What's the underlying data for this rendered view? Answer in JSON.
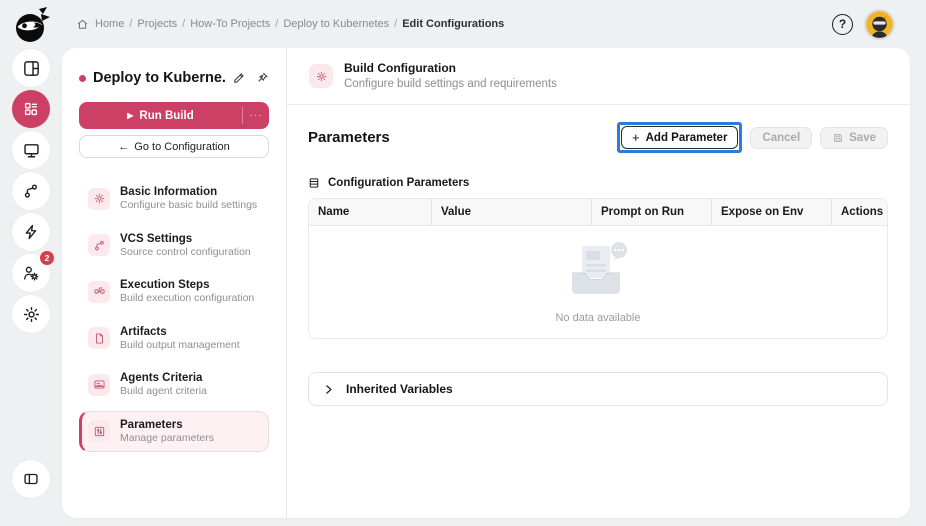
{
  "colors": {
    "accent": "#cd4066",
    "accent_light": "#fbe9ee",
    "highlight_blue": "#2b7ce0",
    "badge_red": "#d5404d",
    "page_bg": "#eef0f1"
  },
  "icons": {
    "breadcrumb_separator": "/",
    "play": "▶",
    "ellipsis": "···",
    "back_arrow": "←",
    "plus": "+",
    "help": "?"
  },
  "breadcrumb": {
    "items": [
      "Home",
      "Projects",
      "How-To Projects",
      "Deploy to Kubernetes",
      "Edit Configurations"
    ]
  },
  "rail": {
    "notifications_badge": "2"
  },
  "left_panel": {
    "title": "Deploy to Kuberne...",
    "run_build_label": "Run Build",
    "go_to_configuration_label": "Go to Configuration",
    "menu": [
      {
        "label": "Basic Information",
        "subtitle": "Configure basic build settings"
      },
      {
        "label": "VCS Settings",
        "subtitle": "Source control configuration"
      },
      {
        "label": "Execution Steps",
        "subtitle": "Build execution configuration"
      },
      {
        "label": "Artifacts",
        "subtitle": "Build output management"
      },
      {
        "label": "Agents Criteria",
        "subtitle": "Build agent criteria"
      },
      {
        "label": "Parameters",
        "subtitle": "Manage parameters"
      }
    ]
  },
  "main": {
    "header": {
      "title": "Build Configuration",
      "subtitle": "Configure build settings and requirements"
    },
    "section_title": "Parameters",
    "add_parameter_label": "Add Parameter",
    "cancel_label": "Cancel",
    "save_label": "Save",
    "table": {
      "section_label": "Configuration Parameters",
      "columns": [
        "Name",
        "Value",
        "Prompt on Run",
        "Expose on Env",
        "Actions"
      ],
      "rows": [],
      "empty_text": "No data available"
    },
    "inherited_label": "Inherited Variables"
  }
}
